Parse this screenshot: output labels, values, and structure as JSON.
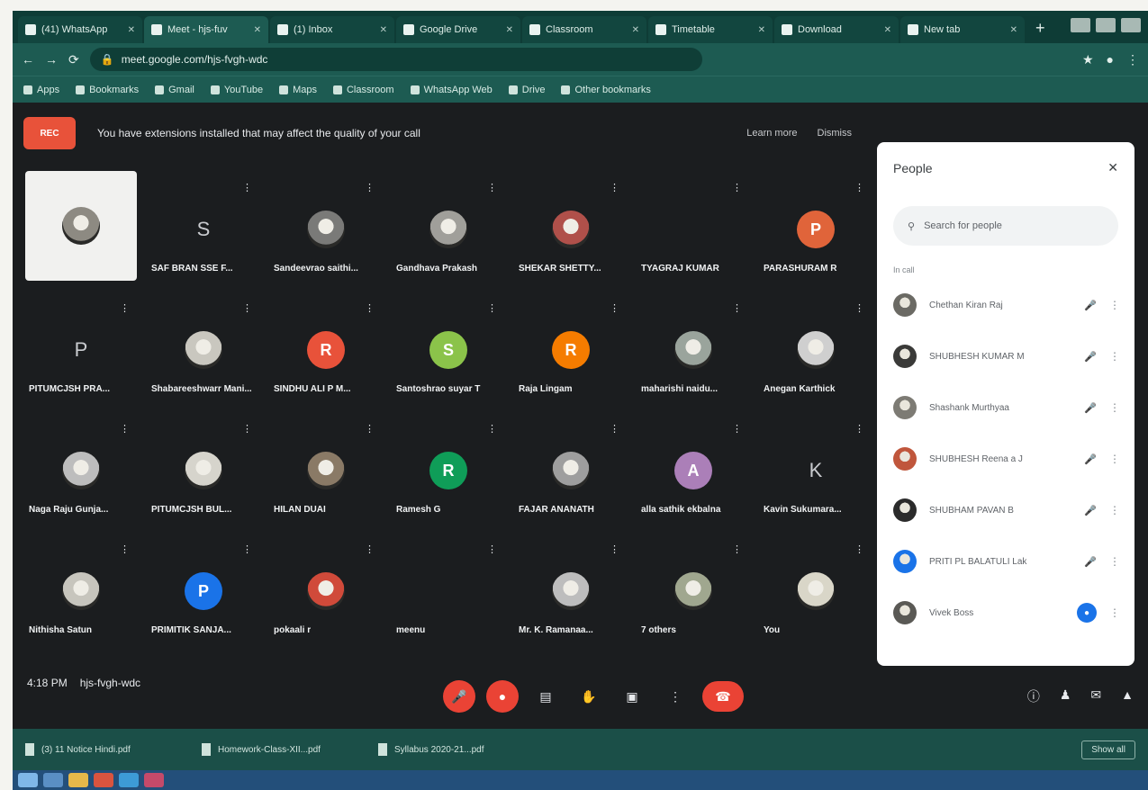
{
  "browser": {
    "tabs": [
      {
        "label": "(41) WhatsApp",
        "active": false
      },
      {
        "label": "Meet - hjs-fuv",
        "active": true
      },
      {
        "label": "(1) Inbox",
        "active": false
      },
      {
        "label": "Google Drive",
        "active": false
      },
      {
        "label": "Classroom",
        "active": false
      },
      {
        "label": "Timetable",
        "active": false
      },
      {
        "label": "Download",
        "active": false
      },
      {
        "label": "New tab",
        "active": false
      }
    ],
    "new_tab": "+",
    "url": "meet.google.com/hjs-fvgh-wdc",
    "bookmarks": [
      "Apps",
      "Bookmarks",
      "Gmail",
      "YouTube",
      "Maps",
      "Classroom",
      "WhatsApp Web",
      "Drive",
      "Other bookmarks"
    ]
  },
  "banner": {
    "badge": "REC",
    "text": "You have extensions installed that may affect the quality of your call",
    "learn_more": "Learn more",
    "dismiss": "Dismiss"
  },
  "participants": [
    {
      "name": "",
      "avatar": "photo",
      "color": "#8d8a82",
      "self": true
    },
    {
      "name": "SAF BRAN SSE F...",
      "avatar": "letter",
      "letter": "S",
      "color": ""
    },
    {
      "name": "Sandeevrao saithi...",
      "avatar": "photo",
      "color": "#7a7a78"
    },
    {
      "name": "Gandhava Prakash",
      "avatar": "photo",
      "color": "#a09f9a"
    },
    {
      "name": "SHEKAR SHETTY...",
      "avatar": "photo",
      "color": "#b0504a"
    },
    {
      "name": "TYAGRAJ KUMAR",
      "avatar": "none",
      "color": ""
    },
    {
      "name": "PARASHURAM R",
      "avatar": "initial",
      "letter": "P",
      "color": "#e0643a"
    },
    {
      "name": "PITUMCJSH PRA...",
      "avatar": "letter",
      "letter": "P",
      "color": ""
    },
    {
      "name": "Shabareeshwarr Mani...",
      "avatar": "photo",
      "color": "#c9c7bf"
    },
    {
      "name": "SINDHU ALI P M...",
      "avatar": "initial",
      "letter": "R",
      "color": "#e8523a"
    },
    {
      "name": "Santoshrao suyar T",
      "avatar": "initial",
      "letter": "S",
      "color": "#8bc34a"
    },
    {
      "name": "Raja Lingam",
      "avatar": "initial",
      "letter": "R",
      "color": "#f57c00"
    },
    {
      "name": "maharishi naidu...",
      "avatar": "photo",
      "color": "#9aa49c"
    },
    {
      "name": "Anegan Karthick",
      "avatar": "photo",
      "color": "#cfcfcf"
    },
    {
      "name": "Naga Raju Gunja...",
      "avatar": "photo",
      "color": "#bdbdbd"
    },
    {
      "name": "PITUMCJSH BUL...",
      "avatar": "photo",
      "color": "#d6d4cc"
    },
    {
      "name": "HILAN DUAI",
      "avatar": "photo",
      "color": "#8a7a66"
    },
    {
      "name": "Ramesh G",
      "avatar": "initial",
      "letter": "R",
      "color": "#0f9d58"
    },
    {
      "name": "FAJAR ANANATH",
      "avatar": "photo",
      "color": "#9e9e9e"
    },
    {
      "name": "alla sathik ekbalna",
      "avatar": "initial",
      "letter": "A",
      "color": "#ab7fb8"
    },
    {
      "name": "Kavin Sukumara...",
      "avatar": "letter",
      "letter": "K",
      "color": ""
    },
    {
      "name": "Nithisha Satun",
      "avatar": "photo",
      "color": "#c7c5bd"
    },
    {
      "name": "PRIMITIK SANJA...",
      "avatar": "initial",
      "letter": "P",
      "color": "#1a73e8"
    },
    {
      "name": "pokaali r",
      "avatar": "photo",
      "color": "#d04a3a"
    },
    {
      "name": "meenu",
      "avatar": "none",
      "color": ""
    },
    {
      "name": "Mr. K. Ramanaa...",
      "avatar": "photo",
      "color": "#bdbdbd"
    },
    {
      "name": "7 others",
      "avatar": "photo",
      "color": "#a0a78f"
    },
    {
      "name": "You",
      "avatar": "photo",
      "color": "#d9d6c8"
    }
  ],
  "people_panel": {
    "title": "People",
    "search_placeholder": "Search for people",
    "section_label": "In call",
    "rows": [
      {
        "name": "Chethan Kiran Raj",
        "color": "#6b6a64",
        "speaking": false
      },
      {
        "name": "SHUBHESH KUMAR M",
        "color": "#3a3a38",
        "speaking": false
      },
      {
        "name": "Shashank Murthyaa",
        "color": "#7d7b74",
        "speaking": false
      },
      {
        "name": "SHUBHESH Reena a J",
        "color": "#c0563c",
        "speaking": false
      },
      {
        "name": "SHUBHAM PAVAN B",
        "color": "#2b2b2b",
        "speaking": false
      },
      {
        "name": "PRITI PL BALATULI Lak",
        "color": "#1a73e8",
        "speaking": false
      },
      {
        "name": "Vivek Boss",
        "color": "#5a5955",
        "speaking": true
      }
    ]
  },
  "bottom": {
    "time": "4:18 PM",
    "meeting_code": "hjs-fvgh-wdc"
  },
  "downloads": [
    "(3) 11 Notice Hindi.pdf",
    "Homework-Class-XII...pdf",
    "Syllabus 2020-21...pdf"
  ],
  "downloads_show_all": "Show all",
  "icons": {
    "mic_off": "mic-off-icon",
    "camera_off": "camera-off-icon",
    "captions": "captions-icon",
    "raise_hand": "raise-hand-icon",
    "present": "present-icon",
    "more": "more-options-icon",
    "hangup": "hangup-icon"
  }
}
